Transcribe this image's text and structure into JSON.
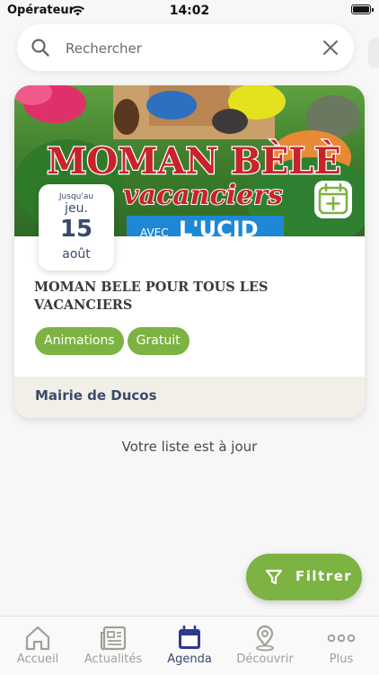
{
  "status_bar": {
    "carrier": "Opérateur",
    "time": "14:02"
  },
  "search": {
    "placeholder": "Rechercher"
  },
  "event": {
    "image_title_line1": "MOMAN BÈLÈ",
    "image_title_line2": "vacanciers",
    "image_banner": "L'UCID",
    "image_banner_small": "AVEC",
    "date_prefix": "Jusqu'au",
    "day_of_week": "jeu.",
    "day": "15",
    "month": "août",
    "title": "MOMAN BELE POUR TOUS LES VACANCIERS",
    "tags": [
      "Animations",
      "Gratuit"
    ],
    "organizer": "Mairie de Ducos"
  },
  "list_status": "Votre liste est à jour",
  "filter_button": {
    "label": "Filtrer"
  },
  "tab_bar": {
    "items": [
      {
        "label": "Accueil",
        "icon": "home-icon"
      },
      {
        "label": "Actualités",
        "icon": "newspaper-icon"
      },
      {
        "label": "Agenda",
        "icon": "calendar-icon",
        "active": true
      },
      {
        "label": "Découvrir",
        "icon": "map-pin-icon"
      },
      {
        "label": "Plus",
        "icon": "more-icon"
      }
    ]
  },
  "colors": {
    "accent_green": "#7cb342",
    "navy": "#3b4a6b",
    "footer_beige": "#f1efe7",
    "tab_inactive": "#a39f97"
  }
}
